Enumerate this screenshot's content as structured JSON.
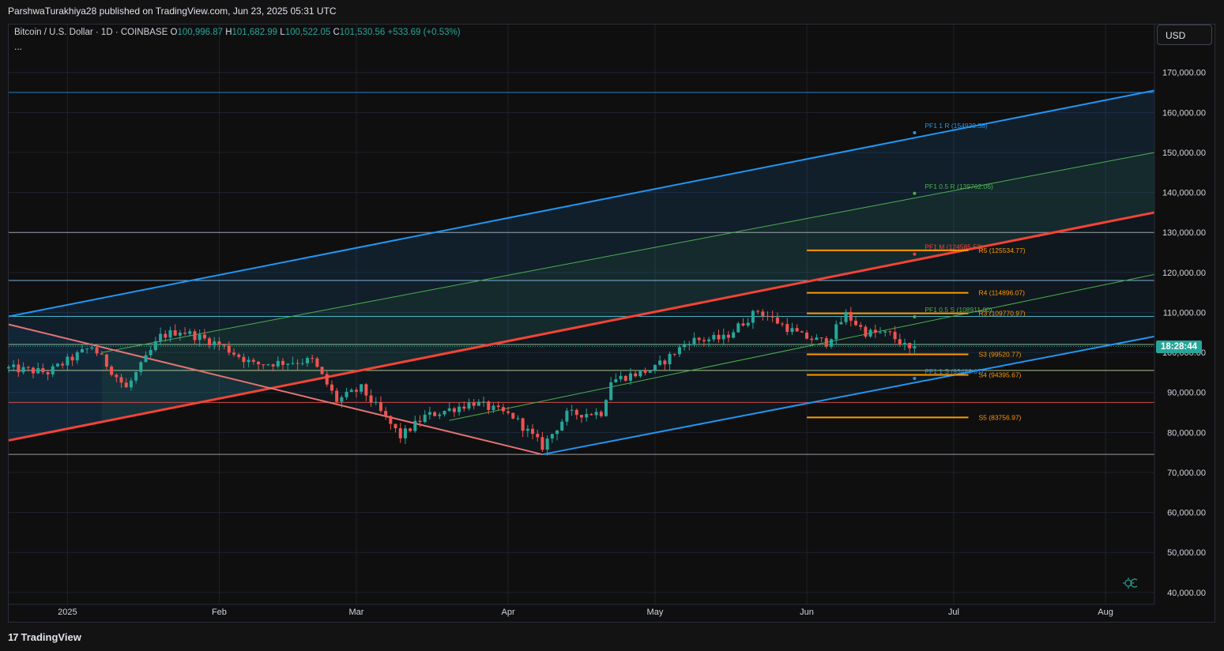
{
  "header": {
    "published_by": "ParshwaTurakhiya28 published on TradingView.com, Jun 23, 2025 05:31 UTC"
  },
  "legend": {
    "symbol": "Bitcoin / U.S. Dollar · 1D · COINBASE",
    "open_label": "O",
    "open": "100,996.87",
    "high_label": "H",
    "high": "101,682.99",
    "low_label": "L",
    "low": "100,522.05",
    "close_label": "C",
    "close": "101,530.56",
    "change": "+533.69 (+0.53%)",
    "more": "..."
  },
  "currency_button": "USD",
  "price_tag": "18:28:44",
  "brand": "TradingView",
  "colors": {
    "background": "#0f0f0f",
    "up_candle": "#26a69a",
    "down_candle": "#ef5350",
    "channel_blue": "#2196f3",
    "channel_red": "#f44336",
    "channel_green": "#4caf50",
    "pivot_orange": "#ff9800"
  },
  "chart_data": {
    "type": "candlestick",
    "symbol": "Bitcoin / U.S. Dollar",
    "timeframe": "1D",
    "exchange": "COINBASE",
    "x_ticks": [
      "2025",
      "Feb",
      "Mar",
      "Apr",
      "May",
      "Jun",
      "Jul",
      "Aug"
    ],
    "x_range": [
      "2024-12-20",
      "2025-08-11"
    ],
    "y_ticks": [
      40000,
      50000,
      60000,
      70000,
      80000,
      90000,
      100000,
      110000,
      120000,
      130000,
      140000,
      150000,
      160000,
      170000
    ],
    "y_tick_labels": [
      "40,000.00",
      "50,000.00",
      "60,000.00",
      "70,000.00",
      "80,000.00",
      "90,000.00",
      "100,000.00",
      "110,000.00",
      "120,000.00",
      "130,000.00",
      "140,000.00",
      "150,000.00",
      "160,000.00",
      "170,000.00"
    ],
    "ylim": [
      37000,
      182000
    ],
    "grid": true,
    "last_close": 101530.56,
    "horizontal_lines": [
      {
        "value": 165000,
        "color": "#2196f3"
      },
      {
        "value": 130000,
        "color": "#b2b5be"
      },
      {
        "value": 118000,
        "color": "#90caf9"
      },
      {
        "value": 109000,
        "color": "#4dd0e1"
      },
      {
        "value": 102000,
        "color": "#a5d6a7"
      },
      {
        "value": 95500,
        "color": "#c5e1a5"
      },
      {
        "value": 87500,
        "color": "#ef5350"
      },
      {
        "value": 74500,
        "color": "#b2b5be"
      }
    ],
    "pivot_levels": [
      {
        "label": "R5 (125534.77)",
        "value": 125534.77
      },
      {
        "label": "R4 (114896.07)",
        "value": 114896.07
      },
      {
        "label": "R3 (109770.97)",
        "value": 109770.97
      },
      {
        "label": "S3 (99520.77)",
        "value": 99520.77
      },
      {
        "label": "S4 (94395.67)",
        "value": 94395.67
      },
      {
        "label": "S5 (83756.97)",
        "value": 83756.97
      }
    ],
    "channel_labels": [
      {
        "label": "PF1 1 R (154939.58)",
        "value": 154939.58,
        "color": "#2196f3"
      },
      {
        "label": "PF1 0.5 R (139762.06)",
        "value": 139762.06,
        "color": "#4caf50"
      },
      {
        "label": "PF1 M (124585.53)",
        "value": 124585.53,
        "color": "#f44336"
      },
      {
        "label": "PF1 0.5 S (108911.80)",
        "value": 108911.8,
        "color": "#4caf50"
      },
      {
        "label": "PF1 1 S (93488.67)",
        "value": 93488.67,
        "color": "#2196f3"
      }
    ],
    "trend_lines": [
      {
        "name": "upper",
        "from": [
          "2024-12-20",
          109000
        ],
        "to": [
          "2025-08-11",
          165500
        ],
        "color": "#2196f3"
      },
      {
        "name": "half-upper",
        "from": [
          "2025-01-08",
          100000
        ],
        "to": [
          "2025-08-11",
          150000
        ],
        "color": "#4caf50"
      },
      {
        "name": "median",
        "from": [
          "2024-12-20",
          78000
        ],
        "to": [
          "2025-08-11",
          135000
        ],
        "color": "#f44336"
      },
      {
        "name": "half-lower",
        "from": [
          "2025-03-20",
          83000
        ],
        "to": [
          "2025-08-11",
          119500
        ],
        "color": "#4caf50"
      },
      {
        "name": "lower",
        "from": [
          "2025-04-08",
          74500
        ],
        "to": [
          "2025-08-11",
          104000
        ],
        "color": "#2196f3"
      },
      {
        "name": "handle",
        "from": [
          "2024-12-20",
          107000
        ],
        "to": [
          "2025-04-08",
          74500
        ],
        "color": "#e57373"
      }
    ],
    "candle_path": [
      [
        "2024-12-20",
        96000
      ],
      [
        "2024-12-28",
        95000
      ],
      [
        "2025-01-06",
        101500
      ],
      [
        "2025-01-13",
        91000
      ],
      [
        "2025-01-20",
        104000
      ],
      [
        "2025-01-24",
        105500
      ],
      [
        "2025-02-01",
        102000
      ],
      [
        "2025-02-08",
        97000
      ],
      [
        "2025-02-20",
        98000
      ],
      [
        "2025-02-25",
        88000
      ],
      [
        "2025-03-02",
        91000
      ],
      [
        "2025-03-10",
        79000
      ],
      [
        "2025-03-15",
        84000
      ],
      [
        "2025-03-25",
        87500
      ],
      [
        "2025-04-02",
        84000
      ],
      [
        "2025-04-08",
        76500
      ],
      [
        "2025-04-13",
        84500
      ],
      [
        "2025-04-20",
        85000
      ],
      [
        "2025-04-22",
        93000
      ],
      [
        "2025-05-01",
        96000
      ],
      [
        "2025-05-08",
        103000
      ],
      [
        "2025-05-15",
        103500
      ],
      [
        "2025-05-22",
        110500
      ],
      [
        "2025-05-31",
        104000
      ],
      [
        "2025-06-05",
        102500
      ],
      [
        "2025-06-09",
        109500
      ],
      [
        "2025-06-13",
        105000
      ],
      [
        "2025-06-18",
        104500
      ],
      [
        "2025-06-22",
        100500
      ],
      [
        "2025-06-23",
        101530
      ]
    ]
  }
}
